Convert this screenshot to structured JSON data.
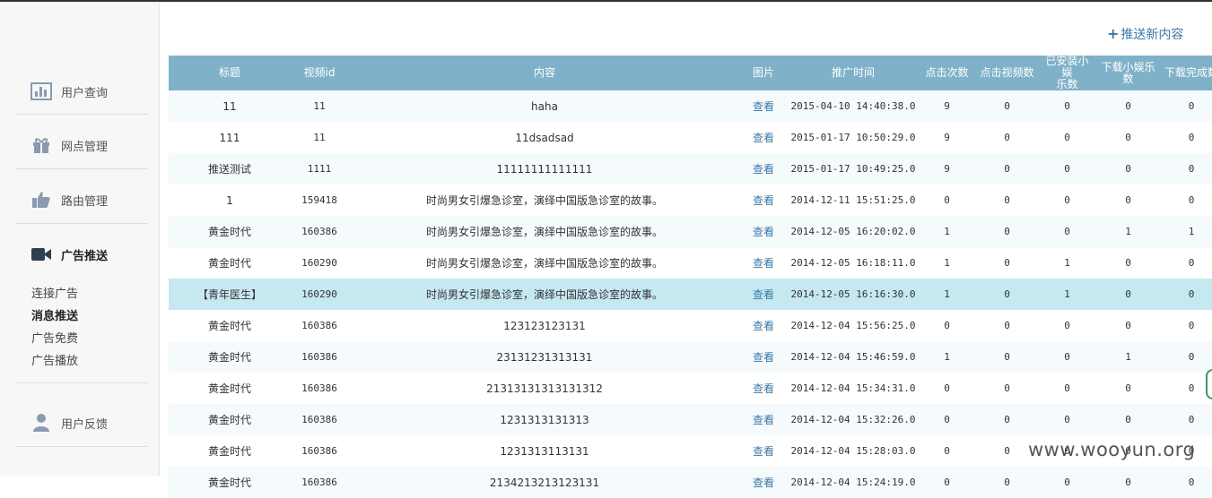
{
  "sidebar": {
    "items": [
      {
        "label": "用户查询",
        "icon": "bar-chart-icon"
      },
      {
        "label": "网点管理",
        "icon": "gift-icon"
      },
      {
        "label": "路由管理",
        "icon": "thumbs-up-icon"
      },
      {
        "label": "广告推送",
        "icon": "video-camera-icon"
      },
      {
        "label": "用户反馈",
        "icon": "user-icon"
      }
    ],
    "subitems": [
      {
        "label": "连接广告"
      },
      {
        "label": "消息推送"
      },
      {
        "label": "广告免费"
      },
      {
        "label": "广告播放"
      }
    ]
  },
  "toolbar": {
    "push_plus": "+",
    "push_label": "推送新内容"
  },
  "table": {
    "headers": {
      "title": "标题",
      "video_id": "视频id",
      "content": "内容",
      "image": "图片",
      "time": "推广时间",
      "clicks": "点击次数",
      "video_clicks": "点击视频数",
      "installed_l1": "已安装小娱",
      "installed_l2": "乐数",
      "downloads_l1": "下载小娱乐",
      "downloads_l2": "数",
      "completed": "下载完成数"
    },
    "view_label": "查看",
    "rows": [
      {
        "title": "11",
        "vid": "11",
        "content": "haha",
        "time": "2015-04-10 14:40:38.0",
        "clicks": "9",
        "video": "0",
        "installed": "0",
        "downloads": "0",
        "completed": "0"
      },
      {
        "title": "111",
        "vid": "11",
        "content": "11dsadsad",
        "time": "2015-01-17 10:50:29.0",
        "clicks": "9",
        "video": "0",
        "installed": "0",
        "downloads": "0",
        "completed": "0"
      },
      {
        "title": "推送测试",
        "vid": "1111",
        "content": "11111111111111",
        "time": "2015-01-17 10:49:25.0",
        "clicks": "9",
        "video": "0",
        "installed": "0",
        "downloads": "0",
        "completed": "0"
      },
      {
        "title": "1",
        "vid": "159418",
        "content": "时尚男女引爆急诊室，演绎中国版急诊室的故事。",
        "time": "2014-12-11 15:51:25.0",
        "clicks": "0",
        "video": "0",
        "installed": "0",
        "downloads": "0",
        "completed": "0"
      },
      {
        "title": "黄金时代",
        "vid": "160386",
        "content": "时尚男女引爆急诊室，演绎中国版急诊室的故事。",
        "time": "2014-12-05 16:20:02.0",
        "clicks": "1",
        "video": "0",
        "installed": "0",
        "downloads": "1",
        "completed": "1"
      },
      {
        "title": "黄金时代",
        "vid": "160290",
        "content": "时尚男女引爆急诊室，演绎中国版急诊室的故事。",
        "time": "2014-12-05 16:18:11.0",
        "clicks": "1",
        "video": "0",
        "installed": "1",
        "downloads": "0",
        "completed": "0"
      },
      {
        "title": "【青年医生】",
        "vid": "160290",
        "content": "时尚男女引爆急诊室，演绎中国版急诊室的故事。",
        "time": "2014-12-05 16:16:30.0",
        "clicks": "1",
        "video": "0",
        "installed": "1",
        "downloads": "0",
        "completed": "0"
      },
      {
        "title": "黄金时代",
        "vid": "160386",
        "content": "123123123131",
        "time": "2014-12-04 15:56:25.0",
        "clicks": "0",
        "video": "0",
        "installed": "0",
        "downloads": "0",
        "completed": "0"
      },
      {
        "title": "黄金时代",
        "vid": "160386",
        "content": "23131231313131",
        "time": "2014-12-04 15:46:59.0",
        "clicks": "1",
        "video": "0",
        "installed": "0",
        "downloads": "1",
        "completed": "0"
      },
      {
        "title": "黄金时代",
        "vid": "160386",
        "content": "21313131313131312",
        "time": "2014-12-04 15:34:31.0",
        "clicks": "0",
        "video": "0",
        "installed": "0",
        "downloads": "0",
        "completed": "0"
      },
      {
        "title": "黄金时代",
        "vid": "160386",
        "content": "1231313131313",
        "time": "2014-12-04 15:32:26.0",
        "clicks": "0",
        "video": "0",
        "installed": "0",
        "downloads": "0",
        "completed": "0"
      },
      {
        "title": "黄金时代",
        "vid": "160386",
        "content": "1231313113131",
        "time": "2014-12-04 15:28:03.0",
        "clicks": "0",
        "video": "0",
        "installed": "0",
        "downloads": "0",
        "completed": "0"
      },
      {
        "title": "黄金时代",
        "vid": "160386",
        "content": "2134213213123131",
        "time": "2014-12-04 15:24:19.0",
        "clicks": "0",
        "video": "0",
        "installed": "0",
        "downloads": "0",
        "completed": "0"
      }
    ]
  },
  "watermark": "www.wooyun.org",
  "colors": {
    "header_bg": "#7fb2c8",
    "highlight_row": "#c6e8f1",
    "link": "#3b78a8",
    "sidebar_bg": "#f7f7f7"
  }
}
